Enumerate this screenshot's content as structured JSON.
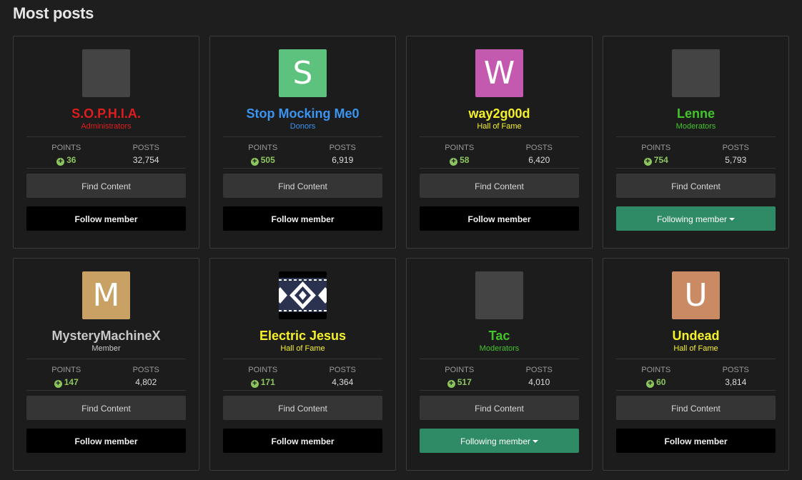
{
  "section_title": "Most posts",
  "labels": {
    "points": "POINTS",
    "posts": "POSTS",
    "find_content": "Find Content",
    "follow": "Follow member",
    "following": "Following member"
  },
  "members": [
    {
      "name": "S.O.P.H.I.A.",
      "group": "Administrators",
      "color": "#e01d1d",
      "group_color": "#e01d1d",
      "points": "36",
      "posts": "32,754",
      "avatar_type": "photo",
      "avatar_letter": "",
      "avatar_bg": "",
      "following": false
    },
    {
      "name": "Stop Mocking Me0",
      "group": "Donors",
      "color": "#3a94f0",
      "group_color": "#3a94f0",
      "points": "505",
      "posts": "6,919",
      "avatar_type": "letter",
      "avatar_letter": "S",
      "avatar_bg": "#5cc27e",
      "following": false
    },
    {
      "name": "way2g00d",
      "group": "Hall of Fame",
      "color": "#f5f12a",
      "group_color": "#f5f12a",
      "points": "58",
      "posts": "6,420",
      "avatar_type": "letter",
      "avatar_letter": "W",
      "avatar_bg": "#c45ab0",
      "following": false
    },
    {
      "name": "Lenne",
      "group": "Moderators",
      "color": "#43c428",
      "group_color": "#43c428",
      "points": "754",
      "posts": "5,793",
      "avatar_type": "photo",
      "avatar_letter": "",
      "avatar_bg": "",
      "following": true
    },
    {
      "name": "MysteryMachineX",
      "group": "Member",
      "color": "#c8c8c8",
      "group_color": "#c8c8c8",
      "points": "147",
      "posts": "4,802",
      "avatar_type": "letter",
      "avatar_letter": "M",
      "avatar_bg": "#c9a164",
      "following": false
    },
    {
      "name": "Electric Jesus",
      "group": "Hall of Fame",
      "color": "#f5f12a",
      "group_color": "#f5f12a",
      "points": "171",
      "posts": "4,364",
      "avatar_type": "photo",
      "avatar_letter": "",
      "avatar_bg": "",
      "following": false
    },
    {
      "name": "Tac",
      "group": "Moderators",
      "color": "#43c428",
      "group_color": "#43c428",
      "points": "517",
      "posts": "4,010",
      "avatar_type": "photo",
      "avatar_letter": "",
      "avatar_bg": "",
      "following": true
    },
    {
      "name": "Undead",
      "group": "Hall of Fame",
      "color": "#f5f12a",
      "group_color": "#f5f12a",
      "points": "60",
      "posts": "3,814",
      "avatar_type": "letter",
      "avatar_letter": "U",
      "avatar_bg": "#c98a64",
      "following": false
    }
  ]
}
